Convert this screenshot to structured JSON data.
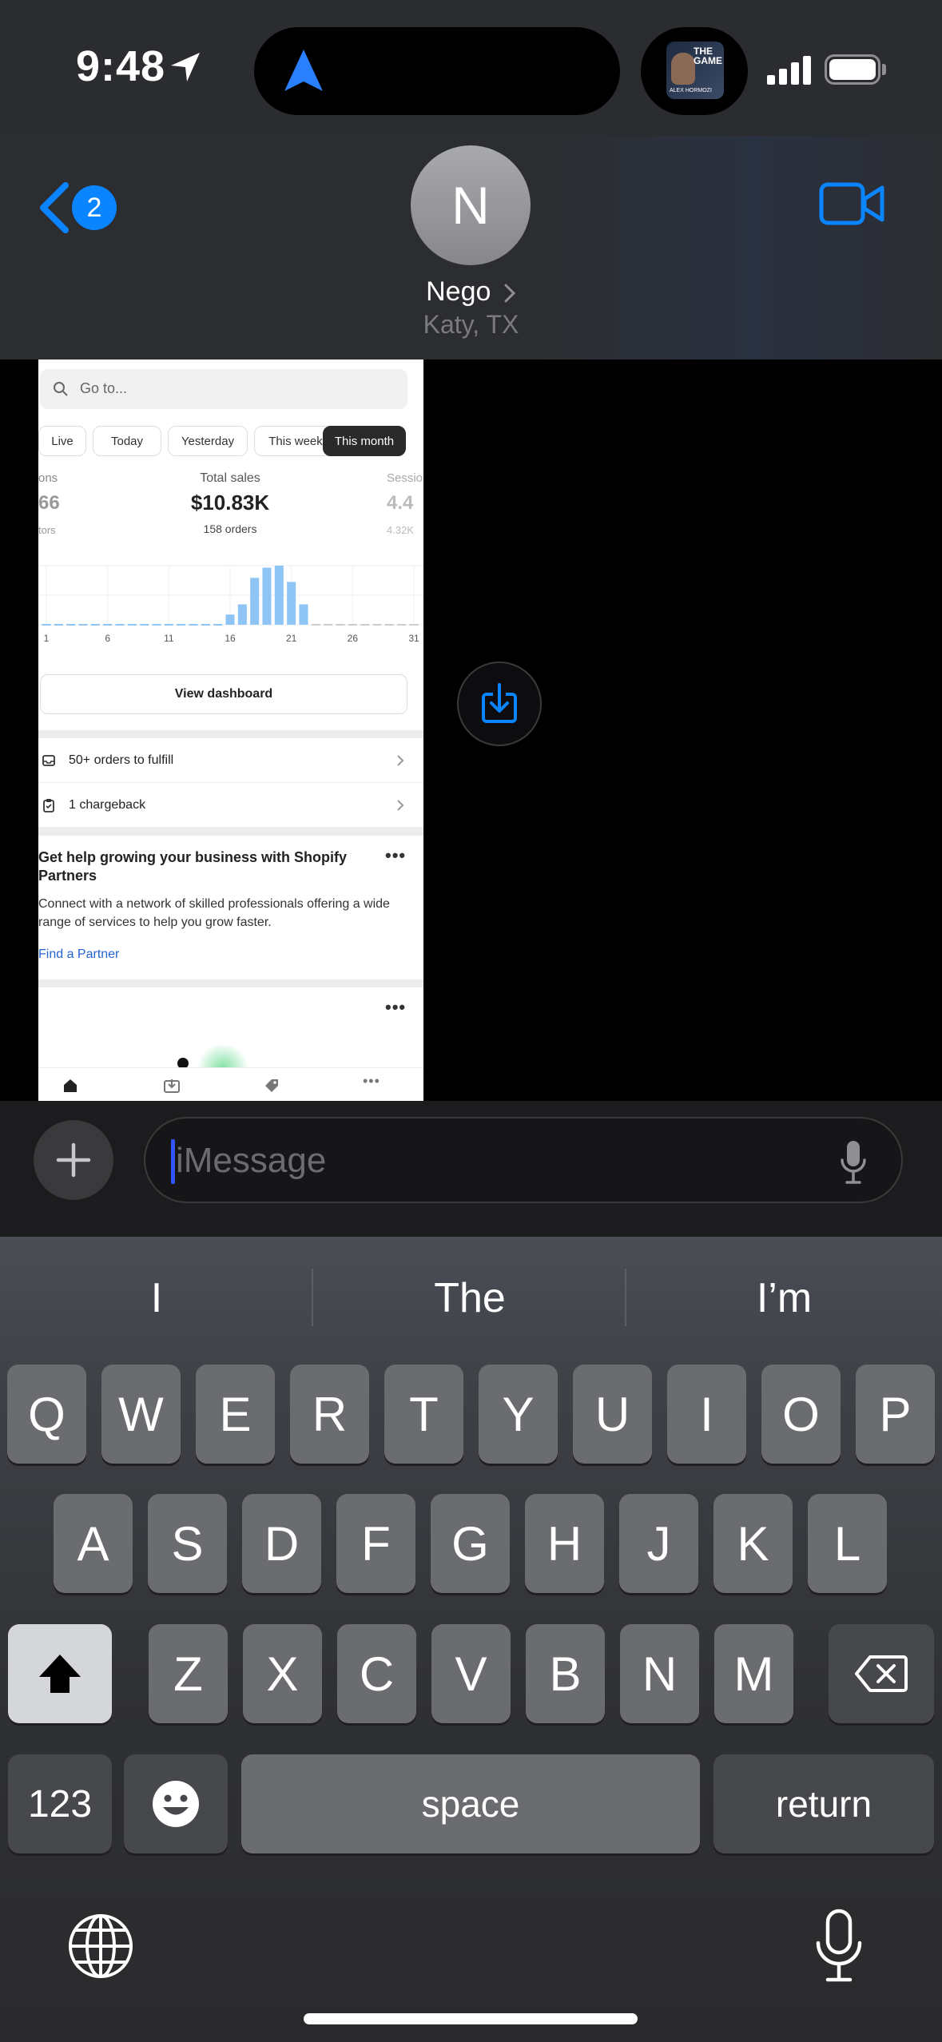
{
  "status": {
    "time": "9:48",
    "island_art_text": "THE GAME",
    "island_art_caption": "ALEX HORMOZI"
  },
  "header": {
    "back_count": "2",
    "avatar_initial": "N",
    "contact_name": "Nego",
    "contact_subtitle": "Katy, TX"
  },
  "attachment": {
    "search_placeholder": "Go to...",
    "filters": [
      "Live",
      "Today",
      "Yesterday",
      "This week",
      "This month"
    ],
    "active_filter": "This month",
    "metrics": {
      "left_label": "ons",
      "left_value": "66",
      "left_sub": "tors",
      "center_label": "Total sales",
      "center_value": "$10.83K",
      "center_sub": "158 orders",
      "right_label": "Sessio",
      "right_value": "4.4",
      "right_sub": "4.32K"
    },
    "chart_data": {
      "type": "bar",
      "x": [
        1,
        2,
        3,
        4,
        5,
        6,
        7,
        8,
        9,
        10,
        11,
        12,
        13,
        14,
        15,
        16,
        17,
        18,
        19,
        20,
        21,
        22,
        23,
        24,
        25,
        26,
        27,
        28,
        29,
        30,
        31
      ],
      "values": [
        1,
        1,
        1,
        1,
        1,
        1,
        1,
        1,
        1,
        1,
        1,
        1,
        1,
        1,
        1,
        5,
        10,
        23,
        28,
        29,
        21,
        10,
        0,
        0,
        0,
        0,
        0,
        0,
        0,
        0,
        0
      ],
      "x_ticks": [
        "1",
        "6",
        "11",
        "16",
        "21",
        "26",
        "31"
      ],
      "grid": true
    },
    "dashboard_button": "View dashboard",
    "rows": [
      "50+ orders to fulfill",
      "1 chargeback"
    ],
    "card_title": "Get help growing your business with Shopify Partners",
    "card_body": "Connect with a network of skilled professionals offering a wide range of services to help you grow faster.",
    "card_link": "Find a Partner",
    "nav_icons": [
      "home-icon",
      "orders-icon",
      "tag-icon",
      "more-icon"
    ]
  },
  "input": {
    "placeholder": "iMessage"
  },
  "keyboard": {
    "suggestions": [
      "I",
      "The",
      "I’m"
    ],
    "row1": [
      "Q",
      "W",
      "E",
      "R",
      "T",
      "Y",
      "U",
      "I",
      "O",
      "P"
    ],
    "row2": [
      "A",
      "S",
      "D",
      "F",
      "G",
      "H",
      "J",
      "K",
      "L"
    ],
    "row3": [
      "Z",
      "X",
      "C",
      "V",
      "B",
      "N",
      "M"
    ],
    "numbers_label": "123",
    "space_label": "space",
    "return_label": "return"
  },
  "colors": {
    "ios_blue": "#0a84ff",
    "shopify_link": "#2463d1",
    "bar_blue": "#8ec5f5"
  }
}
